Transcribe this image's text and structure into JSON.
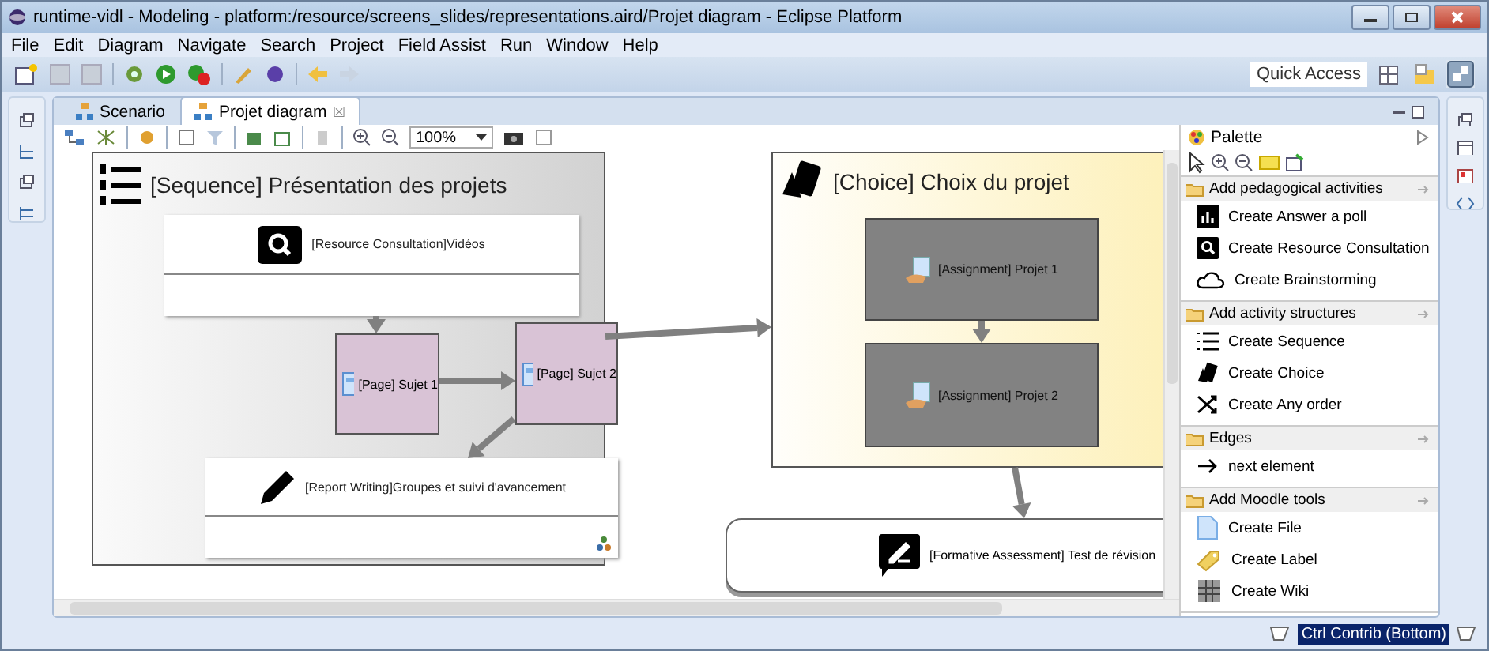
{
  "window": {
    "title": "runtime-vidl - Modeling - platform:/resource/screens_slides/representations.aird/Projet diagram - Eclipse Platform"
  },
  "menu": [
    "File",
    "Edit",
    "Diagram",
    "Navigate",
    "Search",
    "Project",
    "Field Assist",
    "Run",
    "Window",
    "Help"
  ],
  "toolbar": {
    "quick_access": "Quick Access"
  },
  "editor_tabs": [
    {
      "label": "Scenario",
      "selected": false
    },
    {
      "label": "Projet diagram",
      "selected": true,
      "close": "☒"
    }
  ],
  "editor_toolbar": {
    "zoom": "100%"
  },
  "diagram": {
    "sequence": {
      "label": "[Sequence] Présentation des projets",
      "activities": [
        {
          "kind": "resource",
          "label": "[Resource Consultation]Vidéos"
        },
        {
          "kind": "page",
          "label": "[Page] Sujet 1"
        },
        {
          "kind": "page",
          "label": "[Page] Sujet 2"
        },
        {
          "kind": "report",
          "label": "[Report Writing]Groupes et suivi d'avancement"
        }
      ]
    },
    "choice": {
      "label": "[Choice] Choix du projet",
      "activities": [
        {
          "kind": "assignment",
          "label": "[Assignment] Projet 1"
        },
        {
          "kind": "assignment",
          "label": "[Assignment] Projet 2"
        }
      ]
    },
    "assessment": {
      "label": "[Formative Assessment] Test de révision"
    }
  },
  "palette": {
    "title": "Palette",
    "drawers": [
      {
        "label": "Add pedagogical activities",
        "expanded": true,
        "tools": [
          {
            "kind": "poll",
            "label": "Create Answer a poll"
          },
          {
            "kind": "search",
            "label": "Create Resource Consultation"
          },
          {
            "kind": "cloud",
            "label": "Create Brainstorming"
          }
        ]
      },
      {
        "label": "Add activity structures",
        "expanded": true,
        "tools": [
          {
            "kind": "sequence",
            "label": "Create Sequence"
          },
          {
            "kind": "choice",
            "label": "Create Choice"
          },
          {
            "kind": "shuffle",
            "label": "Create Any order"
          }
        ]
      },
      {
        "label": "Edges",
        "expanded": true,
        "tools": [
          {
            "kind": "arrow",
            "label": "next element"
          }
        ]
      },
      {
        "label": "Add Moodle tools",
        "expanded": true,
        "tools": [
          {
            "kind": "file",
            "label": "Create File"
          },
          {
            "kind": "label",
            "label": "Create Label"
          },
          {
            "kind": "wiki",
            "label": "Create Wiki"
          }
        ]
      }
    ]
  },
  "status_bar": {
    "contribution": "Ctrl Contrib (Bottom)"
  }
}
